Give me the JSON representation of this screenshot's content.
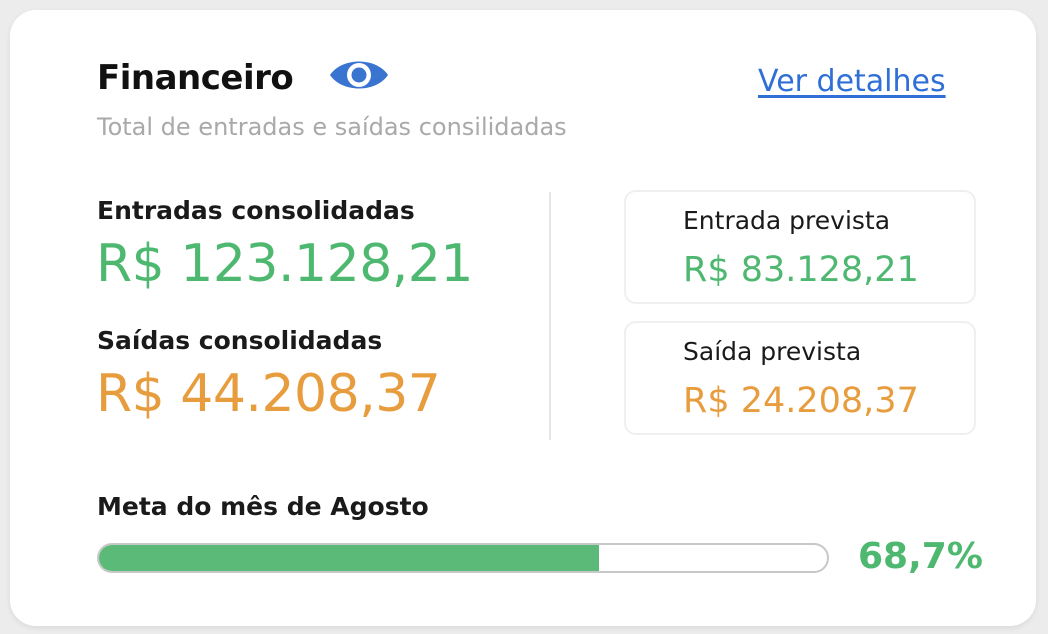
{
  "header": {
    "title": "Financeiro",
    "subtitle": "Total de entradas e saídas consilidadas",
    "details_link": "Ver detalhes",
    "eye_icon": "eye-icon"
  },
  "consolidated": {
    "inflow_label": "Entradas consolidadas",
    "inflow_value": "R$ 123.128,21",
    "outflow_label": "Saídas consolidadas",
    "outflow_value": "R$ 44.208,37"
  },
  "forecast": {
    "inflow_label": "Entrada prevista",
    "inflow_value": "R$ 83.128,21",
    "outflow_label": "Saída prevista",
    "outflow_value": "R$ 24.208,37"
  },
  "goal": {
    "label": "Meta do mês de Agosto",
    "percent_text": "68,7%",
    "progress_fraction": 0.687
  },
  "colors": {
    "inflow": "#4fb870",
    "outflow": "#e79d3e",
    "link": "#2f6fd6",
    "eye": "#3a74d1",
    "progress_fill": "#5cba78"
  }
}
